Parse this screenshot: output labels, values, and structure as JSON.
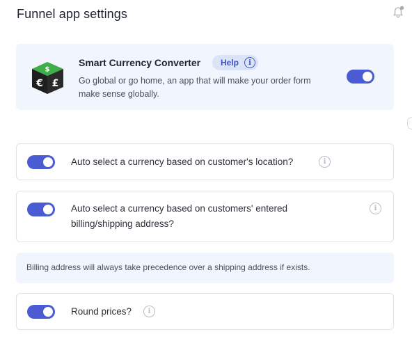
{
  "page": {
    "title": "Funnel app settings"
  },
  "header": {
    "notification_icon": "bell-icon"
  },
  "app": {
    "name": "Smart Currency Converter",
    "help_label": "Help",
    "description": "Go global or go home, an app that will make your order form make sense globally.",
    "enabled": true,
    "logo_icon": "currency-dice-logo"
  },
  "settings": [
    {
      "label": "Auto select a currency based on customer's location?",
      "enabled": true
    },
    {
      "label": "Auto select a currency based on customers' entered billing/shipping address?",
      "enabled": true
    },
    {
      "label": "Round prices?",
      "enabled": true
    }
  ],
  "note": {
    "text": "Billing address will always take precedence over a shipping address if exists."
  },
  "colors": {
    "accent": "#4a5bd3",
    "card_bg": "#f1f5fe",
    "help_badge_bg": "#dbe3f6",
    "help_text": "#3f51c9",
    "logo_green": "#3fae49",
    "logo_dark": "#1e1e1e"
  }
}
